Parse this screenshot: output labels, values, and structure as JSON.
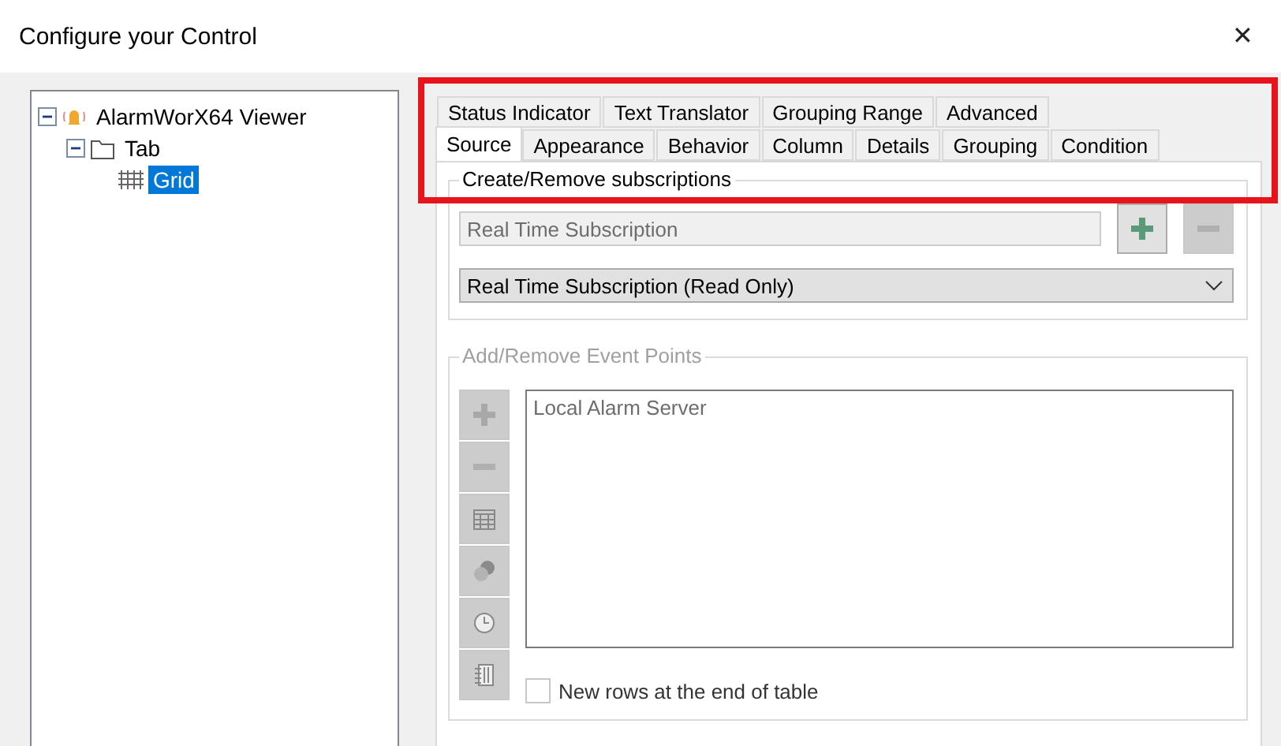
{
  "window": {
    "title": "Configure your Control",
    "close": "✕"
  },
  "tree": [
    {
      "label": "AlarmWorX64 Viewer",
      "kind": "bell",
      "expanded": true,
      "selected": false,
      "children": [
        {
          "label": "Tab",
          "kind": "folder",
          "expanded": true,
          "selected": false,
          "children": [
            {
              "label": "Grid",
              "kind": "grid",
              "selected": true
            }
          ]
        }
      ]
    }
  ],
  "tab_rows": [
    [
      {
        "label": "Status Indicator",
        "selected": false
      },
      {
        "label": "Text Translator",
        "selected": false
      },
      {
        "label": "Grouping Range",
        "selected": false
      },
      {
        "label": "Advanced",
        "selected": false
      }
    ],
    [
      {
        "label": "Source",
        "selected": true
      },
      {
        "label": "Appearance",
        "selected": false
      },
      {
        "label": "Behavior",
        "selected": false
      },
      {
        "label": "Column",
        "selected": false
      },
      {
        "label": "Details",
        "selected": false
      },
      {
        "label": "Grouping",
        "selected": false
      },
      {
        "label": "Condition",
        "selected": false
      }
    ]
  ],
  "subscriptions": {
    "title": "Create/Remove subscriptions",
    "disabled": false,
    "field": {
      "value": "Real Time Subscription",
      "disabled": true
    },
    "buttons": [
      {
        "kind": "add",
        "disabled": false
      },
      {
        "kind": "remove",
        "disabled": true
      }
    ],
    "dropdown": {
      "value": "Real Time Subscription (Read Only)"
    }
  },
  "event_points": {
    "title": "Add/Remove Event Points",
    "disabled": true,
    "buttons": [
      {
        "kind": "add",
        "disabled": true
      },
      {
        "kind": "remove",
        "disabled": true
      },
      {
        "kind": "table",
        "disabled": true
      },
      {
        "kind": "circles",
        "disabled": true
      },
      {
        "kind": "clock",
        "disabled": true
      },
      {
        "kind": "notebook",
        "disabled": true
      }
    ],
    "list": [
      {
        "label": "Local Alarm Server",
        "selected": false
      }
    ],
    "checkbox": {
      "label": "New rows at the end of table",
      "checked": false
    }
  },
  "highlight": {
    "color": "#e8141c"
  }
}
